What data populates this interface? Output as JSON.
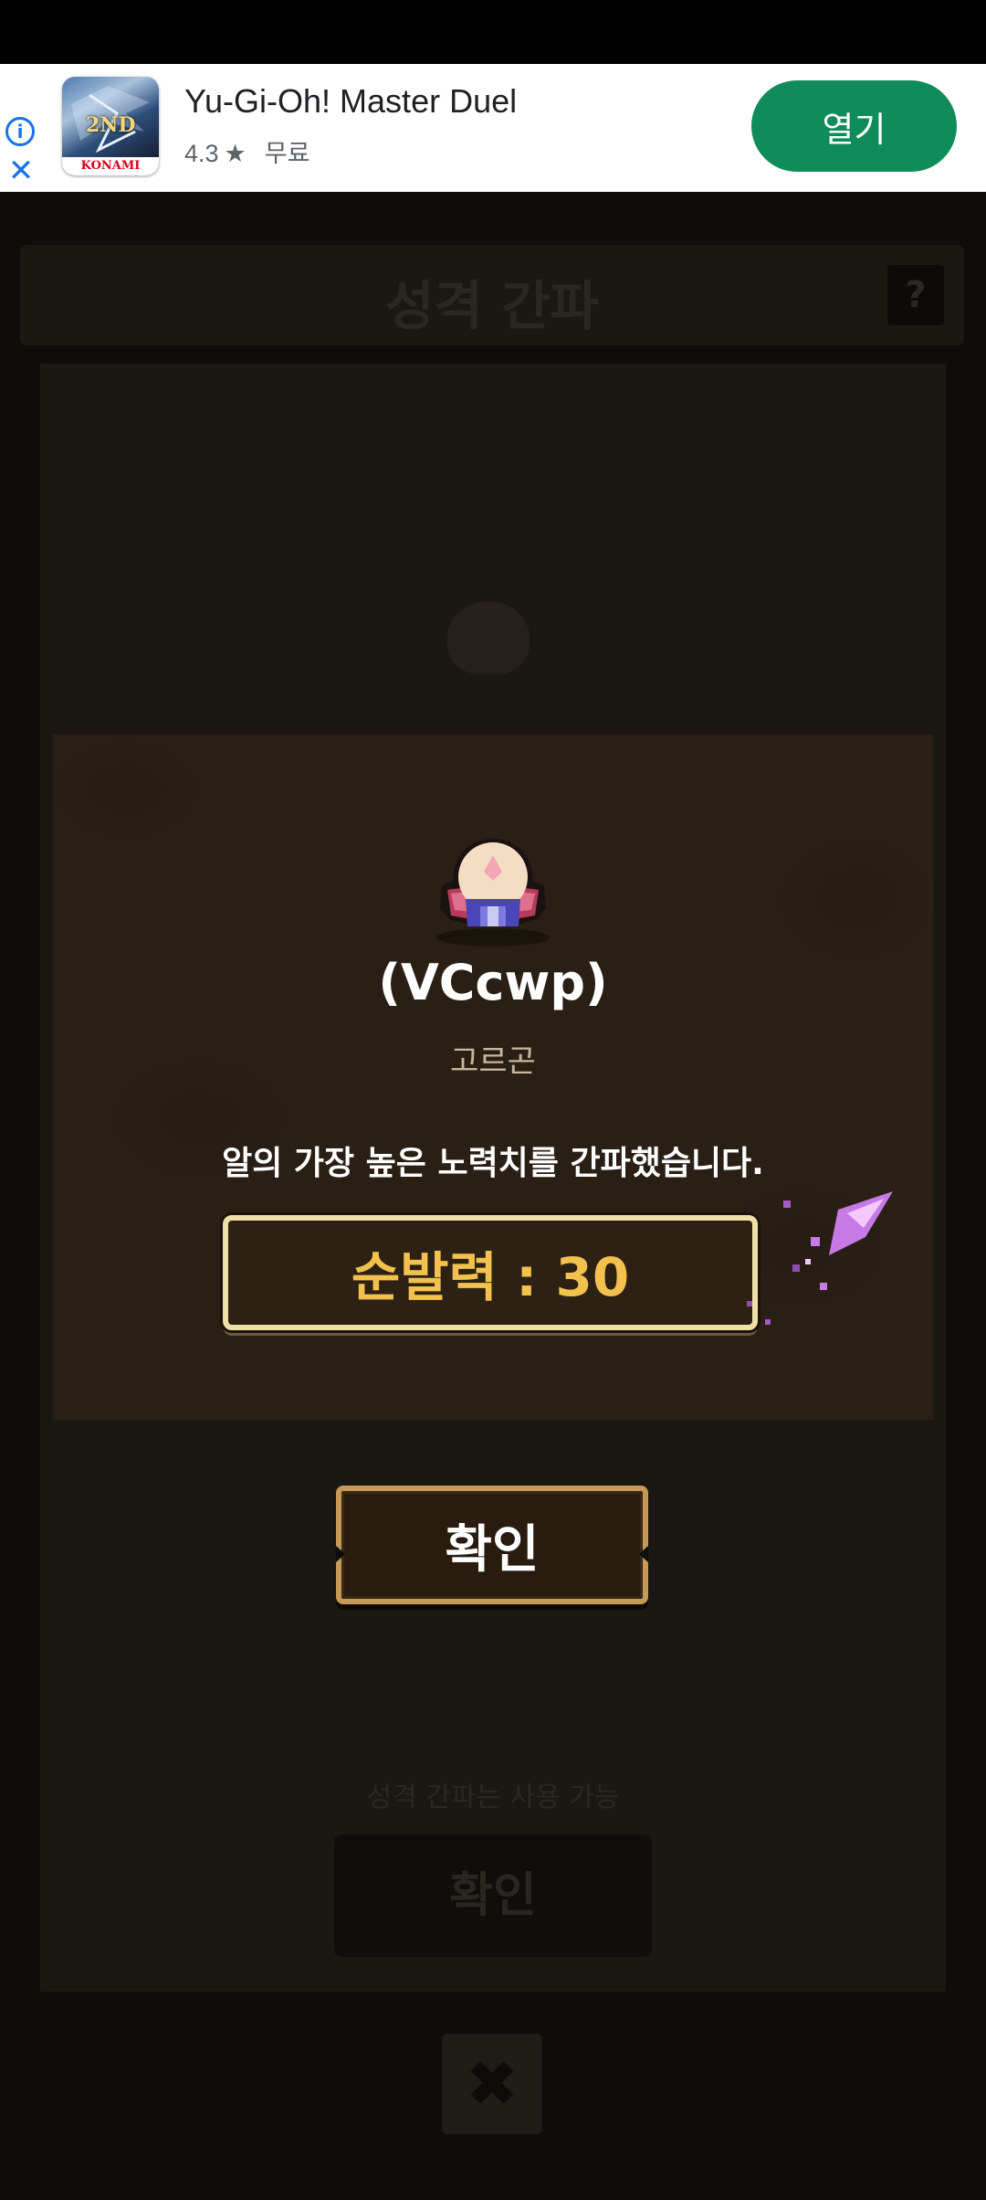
{
  "ad": {
    "app_name": "Yu-Gi-Oh! Master Duel",
    "rating": "4.3",
    "rating_star": "★",
    "price": "무료",
    "open_label": "열기",
    "info_icon": "i",
    "close_icon": "✕",
    "icon_badge": "2ND",
    "icon_brand": "KONAMI"
  },
  "background": {
    "title": "성격 간파",
    "help_icon": "?",
    "note_prefix": "성격 간파는 ",
    "note_highlight": "",
    "note_suffix": "사용 가능",
    "confirm_label": "확인",
    "close_icon": "✖"
  },
  "result": {
    "code": "(VCcwp)",
    "species": "고르곤",
    "message": "알의 가장 높은 노력치를 간파했습니다.",
    "stat_label": "순발력 : 30"
  },
  "confirm_button": {
    "label": "확인"
  },
  "colors": {
    "accent_gold": "#f2c14e",
    "ad_button": "#0f8c5a",
    "panel": "#2a1f15"
  }
}
